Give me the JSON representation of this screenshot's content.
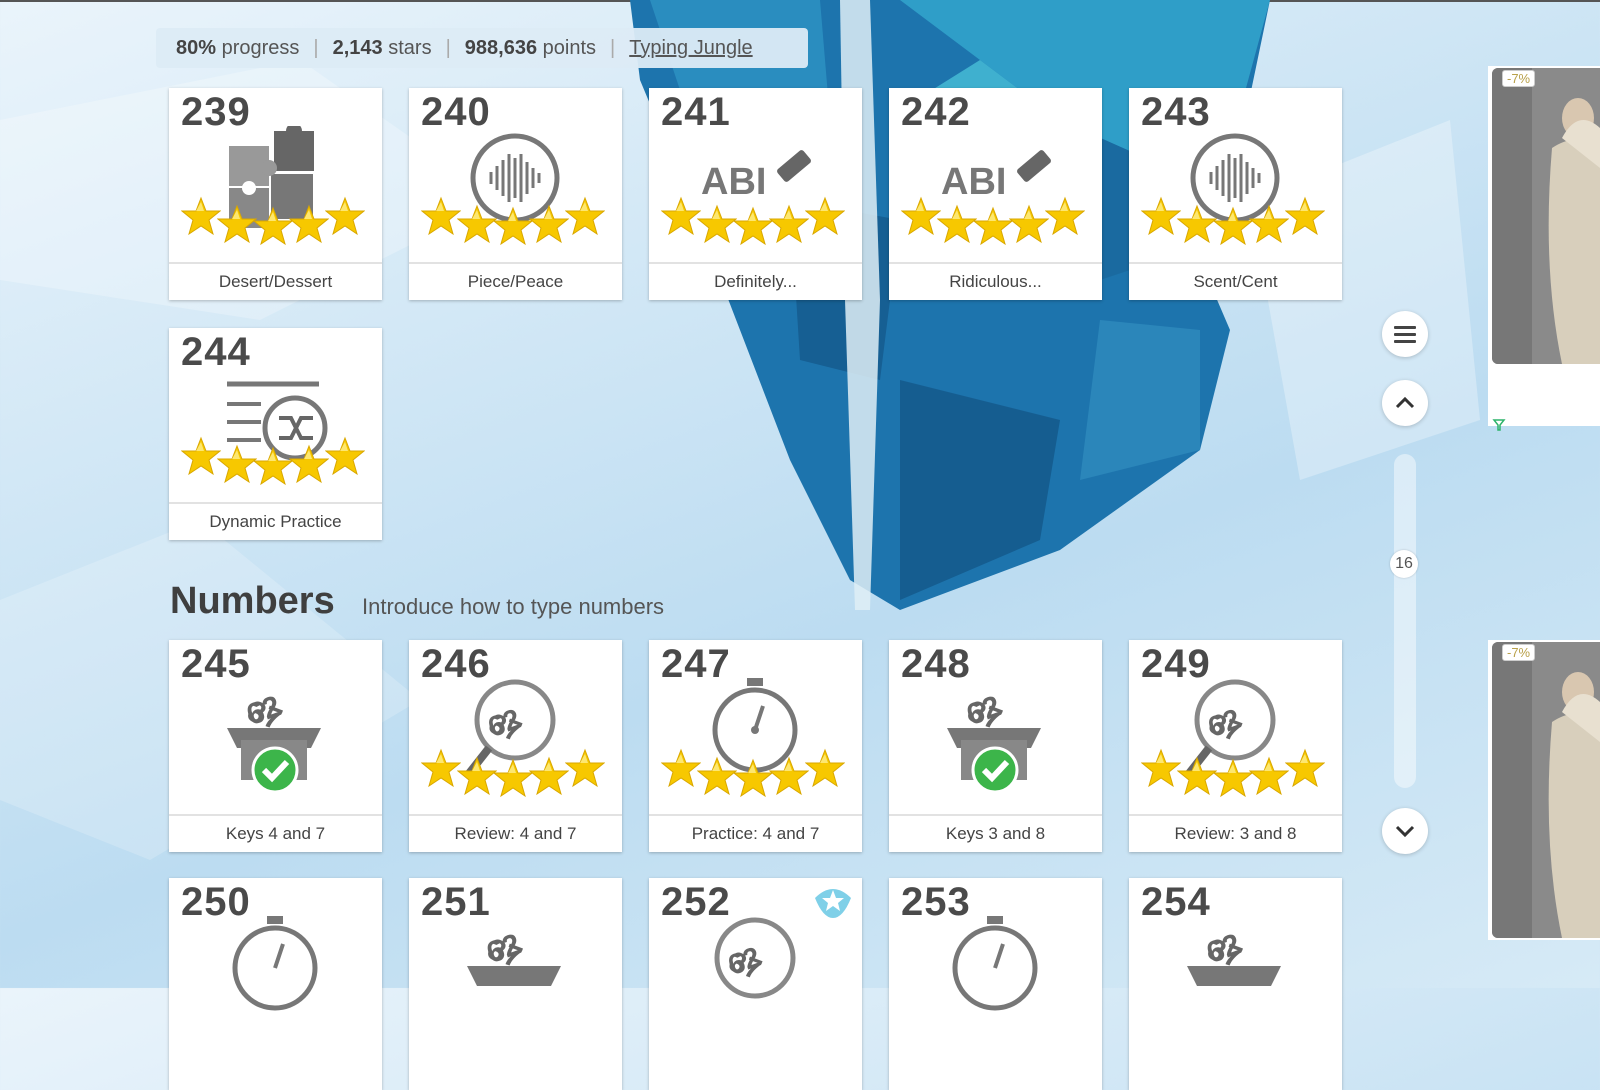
{
  "status": {
    "progress_value": "80%",
    "progress_label": "progress",
    "stars_value": "2,143",
    "stars_label": "stars",
    "points_value": "988,636",
    "points_label": "points",
    "link_label": "Typing Jungle"
  },
  "section": {
    "title": "Numbers",
    "subtitle": "Introduce how to type numbers"
  },
  "cards_top": [
    {
      "num": "239",
      "label": "Desert/Dessert",
      "icon": "puzzle-icon",
      "stars": 5
    },
    {
      "num": "240",
      "label": "Piece/Peace",
      "icon": "audio-wave-icon",
      "stars": 5
    },
    {
      "num": "241",
      "label": "Definitely...",
      "icon": "spelling-abc-icon",
      "stars": 5
    },
    {
      "num": "242",
      "label": "Ridiculous...",
      "icon": "spelling-abc-icon",
      "stars": 5
    },
    {
      "num": "243",
      "label": "Scent/Cent",
      "icon": "audio-wave-icon",
      "stars": 5
    },
    {
      "num": "244",
      "label": "Dynamic Practice",
      "icon": "shuffle-list-icon",
      "stars": 5
    }
  ],
  "cards_numbers": [
    {
      "num": "245",
      "label": "Keys 4 and 7",
      "icon": "number-box-icon",
      "status": "completed-check"
    },
    {
      "num": "246",
      "label": "Review: 4 and 7",
      "icon": "number-magnifier-icon",
      "stars": 5
    },
    {
      "num": "247",
      "label": "Practice: 4 and 7",
      "icon": "stopwatch-icon",
      "stars": 5
    },
    {
      "num": "248",
      "label": "Keys 3 and 8",
      "icon": "number-box-icon",
      "status": "completed-check"
    },
    {
      "num": "249",
      "label": "Review: 3 and 8",
      "icon": "number-magnifier-icon",
      "stars": 5
    }
  ],
  "cards_bottom": [
    {
      "num": "250",
      "icon": "stopwatch-icon"
    },
    {
      "num": "251",
      "icon": "number-box-icon"
    },
    {
      "num": "252",
      "icon": "number-magnifier-icon",
      "badge": "star-badge-icon"
    },
    {
      "num": "253",
      "icon": "stopwatch-icon"
    },
    {
      "num": "254",
      "icon": "number-box-icon"
    }
  ],
  "scroll": {
    "page_badge": "16"
  },
  "ads": [
    {
      "discount": "-7%"
    },
    {
      "discount": "-7%"
    }
  ],
  "colors": {
    "star_yellow": "#f7c800",
    "check_green": "#3cb54a",
    "iceberg_blue": "#1b6fa6"
  }
}
